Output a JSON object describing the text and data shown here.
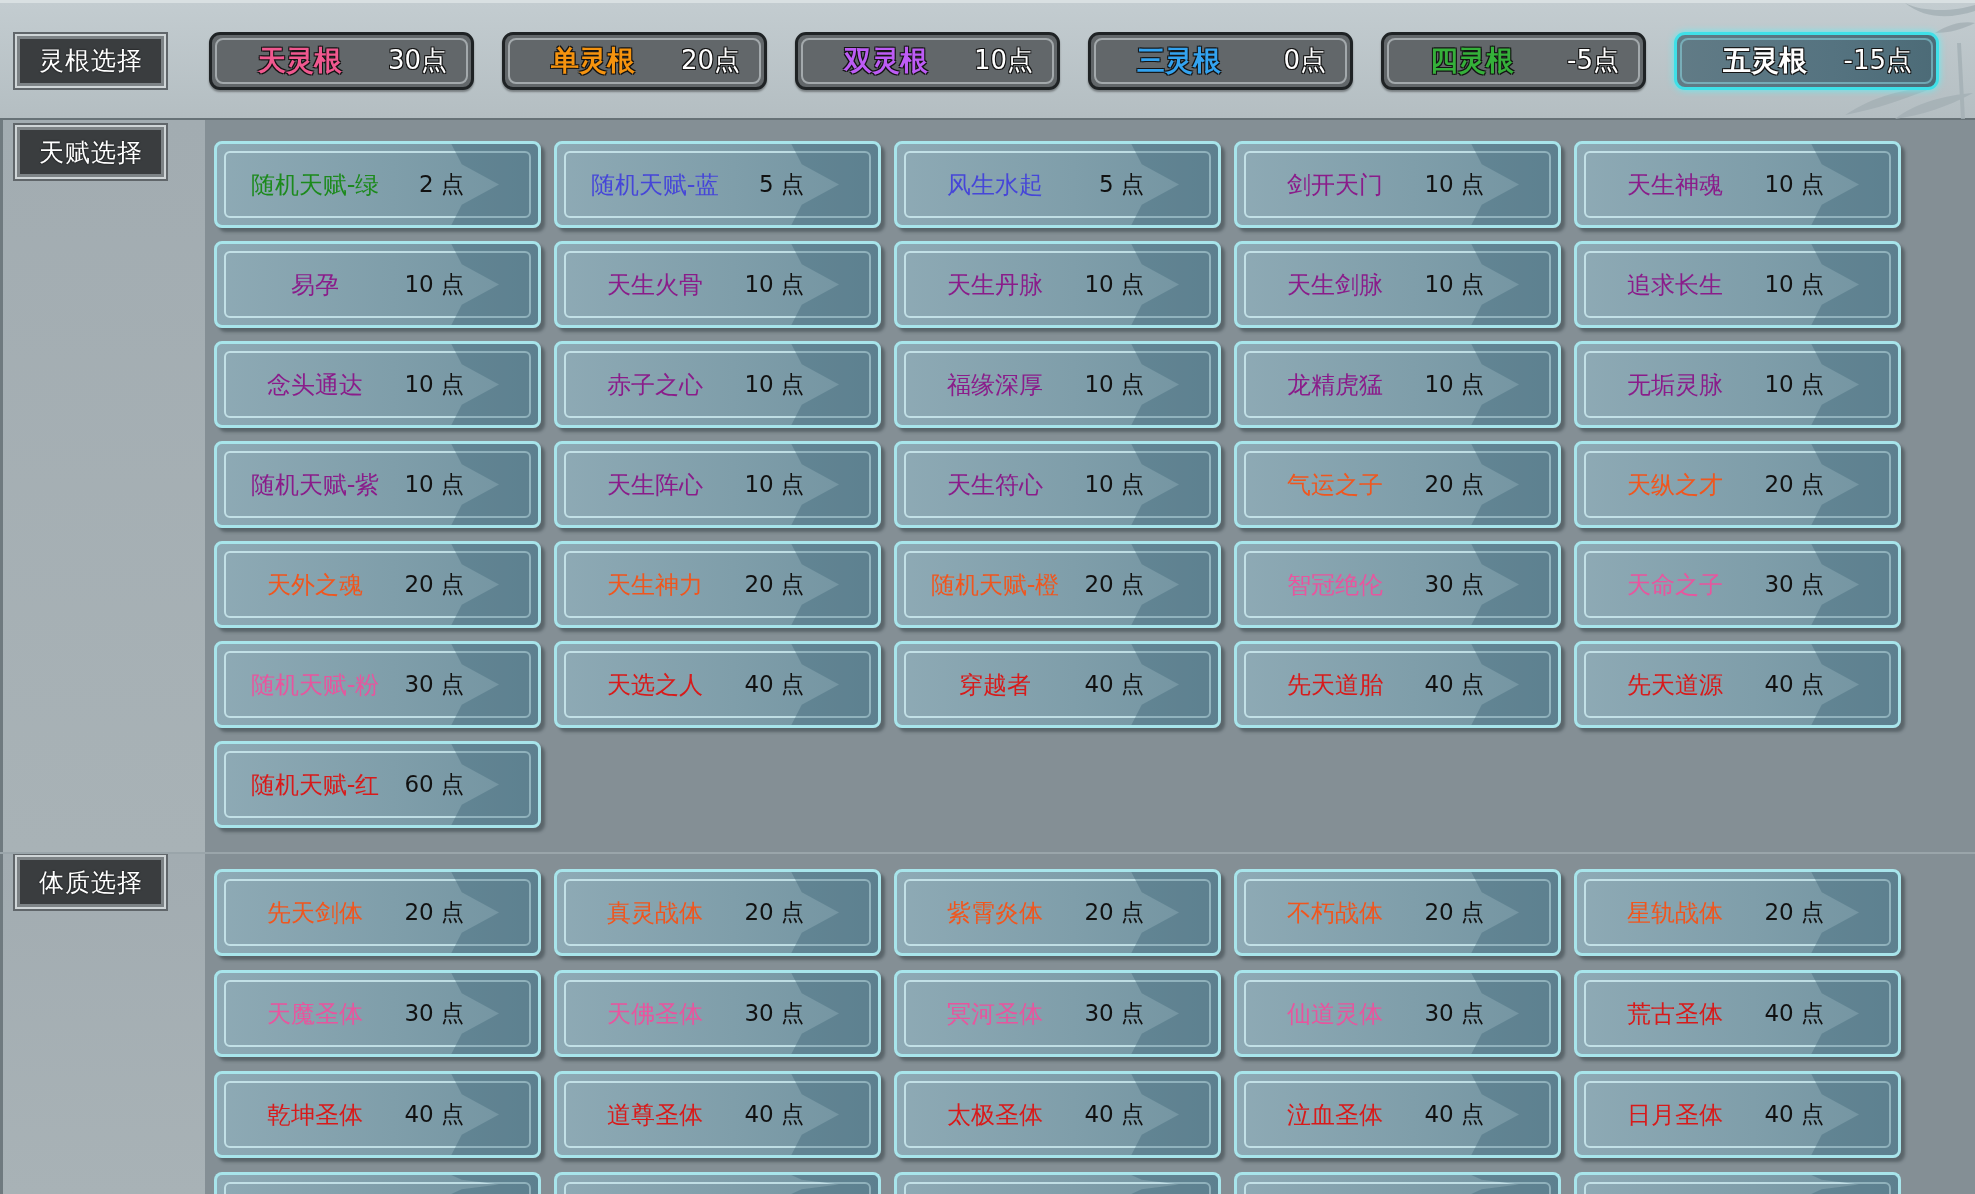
{
  "root_selection": {
    "label": "灵根选择",
    "options": [
      {
        "name": "天灵根",
        "cost": "30点",
        "color": "#f0588f",
        "selected": false
      },
      {
        "name": "单灵根",
        "cost": "20点",
        "color": "#f5930f",
        "selected": false
      },
      {
        "name": "双灵根",
        "cost": "10点",
        "color": "#bd5cf5",
        "selected": false
      },
      {
        "name": "三灵根",
        "cost": "0点",
        "color": "#33a3f0",
        "selected": false
      },
      {
        "name": "四灵根",
        "cost": "-5点",
        "color": "#35b03a",
        "selected": false
      },
      {
        "name": "五灵根",
        "cost": "-15点",
        "color": "#ffffff",
        "selected": true
      }
    ]
  },
  "talent_selection": {
    "label": "天赋选择",
    "items": [
      {
        "name": "随机天赋-绿",
        "cost": "2 点",
        "color": "#1c8a1c"
      },
      {
        "name": "随机天赋-蓝",
        "cost": "5 点",
        "color": "#4646d8"
      },
      {
        "name": "风生水起",
        "cost": "5 点",
        "color": "#4646d8"
      },
      {
        "name": "剑开天门",
        "cost": "10 点",
        "color": "#8a1c8a"
      },
      {
        "name": "天生神魂",
        "cost": "10 点",
        "color": "#8a1c8a"
      },
      {
        "name": "易孕",
        "cost": "10 点",
        "color": "#8a1c8a"
      },
      {
        "name": "天生火骨",
        "cost": "10 点",
        "color": "#8a1c8a"
      },
      {
        "name": "天生丹脉",
        "cost": "10 点",
        "color": "#8a1c8a"
      },
      {
        "name": "天生剑脉",
        "cost": "10 点",
        "color": "#8a1c8a"
      },
      {
        "name": "追求长生",
        "cost": "10 点",
        "color": "#8a1c8a"
      },
      {
        "name": "念头通达",
        "cost": "10 点",
        "color": "#8a1c8a"
      },
      {
        "name": "赤子之心",
        "cost": "10 点",
        "color": "#8a1c8a"
      },
      {
        "name": "福缘深厚",
        "cost": "10 点",
        "color": "#8a1c8a"
      },
      {
        "name": "龙精虎猛",
        "cost": "10 点",
        "color": "#8a1c8a"
      },
      {
        "name": "无垢灵脉",
        "cost": "10 点",
        "color": "#8a1c8a"
      },
      {
        "name": "随机天赋-紫",
        "cost": "10 点",
        "color": "#8a1c8a"
      },
      {
        "name": "天生阵心",
        "cost": "10 点",
        "color": "#8a1c8a"
      },
      {
        "name": "天生符心",
        "cost": "10 点",
        "color": "#8a1c8a"
      },
      {
        "name": "气运之子",
        "cost": "20 点",
        "color": "#f0561e"
      },
      {
        "name": "天纵之才",
        "cost": "20 点",
        "color": "#f0561e"
      },
      {
        "name": "天外之魂",
        "cost": "20 点",
        "color": "#f0561e"
      },
      {
        "name": "天生神力",
        "cost": "20 点",
        "color": "#f0561e"
      },
      {
        "name": "随机天赋-橙",
        "cost": "20 点",
        "color": "#f0561e"
      },
      {
        "name": "智冠绝伦",
        "cost": "30 点",
        "color": "#e8559e"
      },
      {
        "name": "天命之子",
        "cost": "30 点",
        "color": "#e8559e"
      },
      {
        "name": "随机天赋-粉",
        "cost": "30 点",
        "color": "#e8559e"
      },
      {
        "name": "天选之人",
        "cost": "40 点",
        "color": "#d81a1a"
      },
      {
        "name": "穿越者",
        "cost": "40 点",
        "color": "#d81a1a"
      },
      {
        "name": "先天道胎",
        "cost": "40 点",
        "color": "#d81a1a"
      },
      {
        "name": "先天道源",
        "cost": "40 点",
        "color": "#d81a1a"
      },
      {
        "name": "随机天赋-红",
        "cost": "60 点",
        "color": "#d81a1a"
      }
    ]
  },
  "constitution_selection": {
    "label": "体质选择",
    "items": [
      {
        "kind": "full",
        "name": "先天剑体",
        "cost": "20 点",
        "color": "#f0561e"
      },
      {
        "kind": "full",
        "name": "真灵战体",
        "cost": "20 点",
        "color": "#f0561e"
      },
      {
        "kind": "full",
        "name": "紫霄炎体",
        "cost": "20 点",
        "color": "#f0561e"
      },
      {
        "kind": "full",
        "name": "不朽战体",
        "cost": "20 点",
        "color": "#f0561e"
      },
      {
        "kind": "full",
        "name": "星轨战体",
        "cost": "20 点",
        "color": "#f0561e"
      },
      {
        "kind": "full",
        "name": "天魔圣体",
        "cost": "30 点",
        "color": "#e8559e"
      },
      {
        "kind": "full",
        "name": "天佛圣体",
        "cost": "30 点",
        "color": "#e8559e"
      },
      {
        "kind": "full",
        "name": "冥河圣体",
        "cost": "30 点",
        "color": "#e8559e"
      },
      {
        "kind": "full",
        "name": "仙道灵体",
        "cost": "30 点",
        "color": "#e8559e"
      },
      {
        "kind": "full",
        "name": "荒古圣体",
        "cost": "40 点",
        "color": "#d81a1a"
      },
      {
        "kind": "full",
        "name": "乾坤圣体",
        "cost": "40 点",
        "color": "#d81a1a"
      },
      {
        "kind": "full",
        "name": "道尊圣体",
        "cost": "40 点",
        "color": "#d81a1a"
      },
      {
        "kind": "full",
        "name": "太极圣体",
        "cost": "40 点",
        "color": "#d81a1a"
      },
      {
        "kind": "full",
        "name": "泣血圣体",
        "cost": "40 点",
        "color": "#d81a1a"
      },
      {
        "kind": "full",
        "name": "日月圣体",
        "cost": "40 点",
        "color": "#d81a1a"
      },
      {
        "kind": "partial"
      },
      {
        "kind": "partial"
      },
      {
        "kind": "partial"
      },
      {
        "kind": "partial"
      },
      {
        "kind": "partial"
      }
    ]
  }
}
